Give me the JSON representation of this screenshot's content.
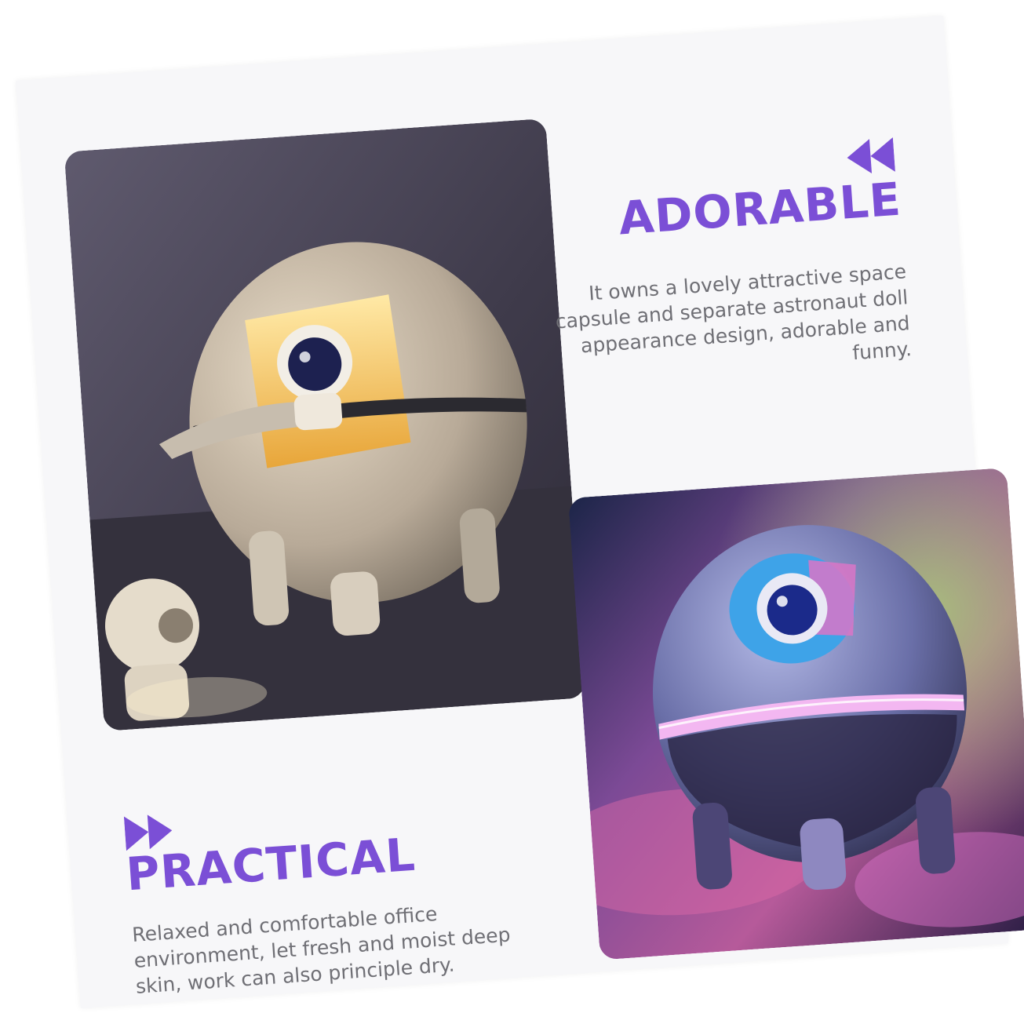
{
  "sections": [
    {
      "heading": "ADORABLE",
      "body": "It owns a lovely attractive space capsule and separate astronaut doll appearance design, adorable and funny.",
      "icon": "rewind-icon"
    },
    {
      "heading": "PRACTICAL",
      "body": "Relaxed and comfortable office environment, let fresh and moist deep skin, work can also principle dry.",
      "icon": "fast-forward-icon"
    }
  ],
  "colors": {
    "accent": "#7b4fd6",
    "body_text": "#6f6f75",
    "card_background": "#f7f7f9"
  }
}
